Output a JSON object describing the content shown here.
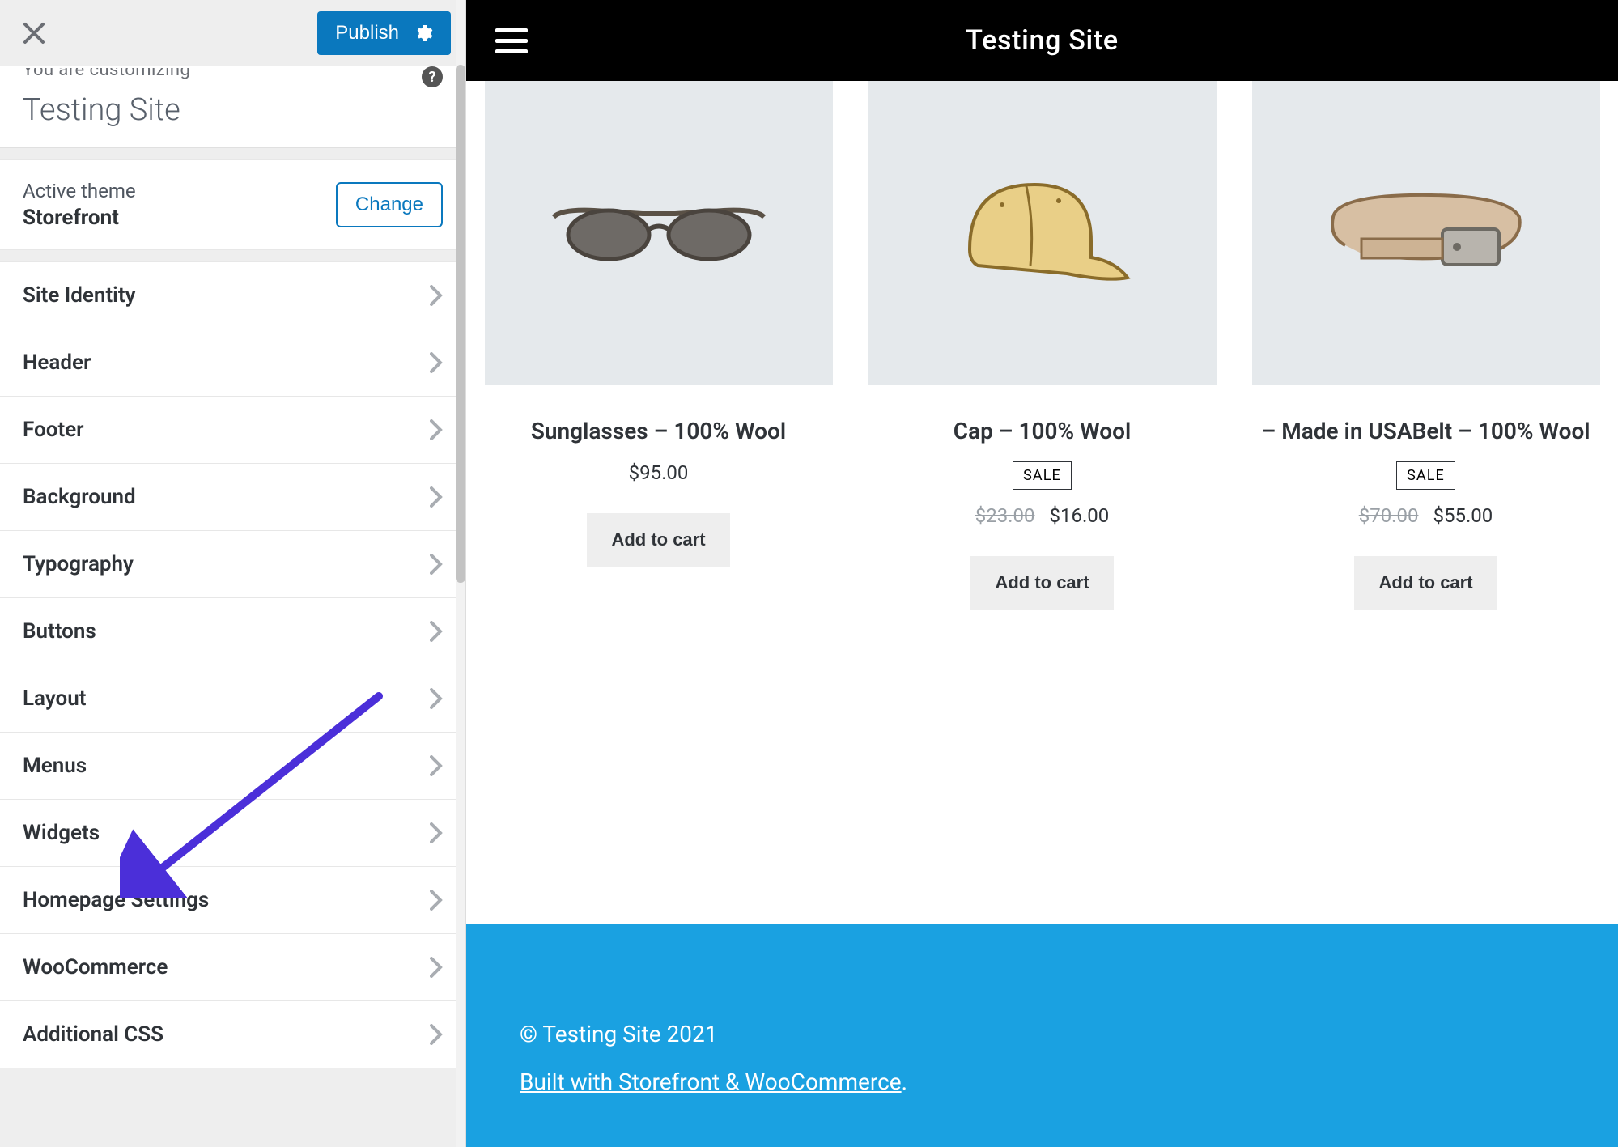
{
  "customizer": {
    "publish_label": "Publish",
    "customizing_label": "You are customizing",
    "site_title": "Testing Site",
    "theme": {
      "active_label": "Active theme",
      "name": "Storefront",
      "change_label": "Change"
    },
    "items": [
      {
        "label": "Site Identity"
      },
      {
        "label": "Header"
      },
      {
        "label": "Footer"
      },
      {
        "label": "Background"
      },
      {
        "label": "Typography"
      },
      {
        "label": "Buttons"
      },
      {
        "label": "Layout"
      },
      {
        "label": "Menus"
      },
      {
        "label": "Widgets"
      },
      {
        "label": "Homepage Settings"
      },
      {
        "label": "WooCommerce"
      },
      {
        "label": "Additional CSS"
      }
    ]
  },
  "preview": {
    "header_title": "Testing Site",
    "products": [
      {
        "name": "Sunglasses – 100% Wool",
        "price": "$95.00",
        "old_price": "",
        "badge": "",
        "add_label": "Add to cart",
        "icon": "sunglasses"
      },
      {
        "name": "Cap – 100% Wool",
        "price": "$16.00",
        "old_price": "$23.00",
        "badge": "SALE",
        "add_label": "Add to cart",
        "icon": "cap"
      },
      {
        "name": "– Made in USABelt – 100% Wool",
        "price": "$55.00",
        "old_price": "$70.00",
        "badge": "SALE",
        "add_label": "Add to cart",
        "icon": "belt"
      }
    ],
    "footer": {
      "copyright": "© Testing Site 2021",
      "credit": "Built with Storefront & WooCommerce",
      "period": "."
    }
  }
}
